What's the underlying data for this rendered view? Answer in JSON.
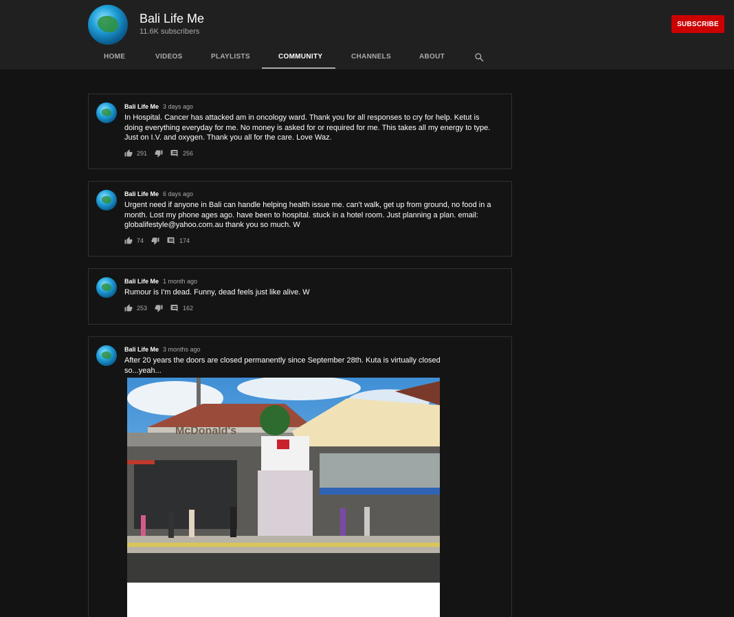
{
  "channel": {
    "name": "Bali Life Me",
    "subscribers": "11.6K subscribers",
    "subscribe_label": "SUBSCRIBE",
    "accent": "#cc0000"
  },
  "tabs": [
    {
      "label": "HOME",
      "active": false
    },
    {
      "label": "VIDEOS",
      "active": false
    },
    {
      "label": "PLAYLISTS",
      "active": false
    },
    {
      "label": "COMMUNITY",
      "active": true
    },
    {
      "label": "CHANNELS",
      "active": false
    },
    {
      "label": "ABOUT",
      "active": false
    }
  ],
  "icons": {
    "search": "search-icon",
    "like": "thumbs-up-icon",
    "dislike": "thumbs-down-icon",
    "comments": "comment-icon"
  },
  "posts": [
    {
      "author": "Bali Life Me",
      "time": "3 days ago",
      "text": "In Hospital. Cancer has attacked am in oncology ward. Thank you for all responses to cry for help. Ketut is doing everything everyday for me. No money is asked for or required for me. This takes all my energy to type. Just on I.V. and oxygen. Thank you all for the care. Love Waz.",
      "likes": "291",
      "comments": "256"
    },
    {
      "author": "Bali Life Me",
      "time": "6 days ago",
      "text": "Urgent need if anyone in Bali can handle helping  health issue me. can't walk, get up from ground, no food in a month. Lost my phone ages ago. have been to hospital. stuck in a hotel room. Just planning a plan. email: globalifestyle@yahoo.com.au  thank you so much. W",
      "likes": "74",
      "comments": "174"
    },
    {
      "author": "Bali Life Me",
      "time": "1 month ago",
      "text": "Rumour is I'm dead. Funny, dead feels just like alive. W",
      "likes": "253",
      "comments": "162"
    },
    {
      "author": "Bali Life Me",
      "time": "3 months ago",
      "text": "After 20 years the doors are closed permanently since September 28th. Kuta is virtually closed so...yeah...",
      "image_sign": "McDonald's"
    }
  ]
}
